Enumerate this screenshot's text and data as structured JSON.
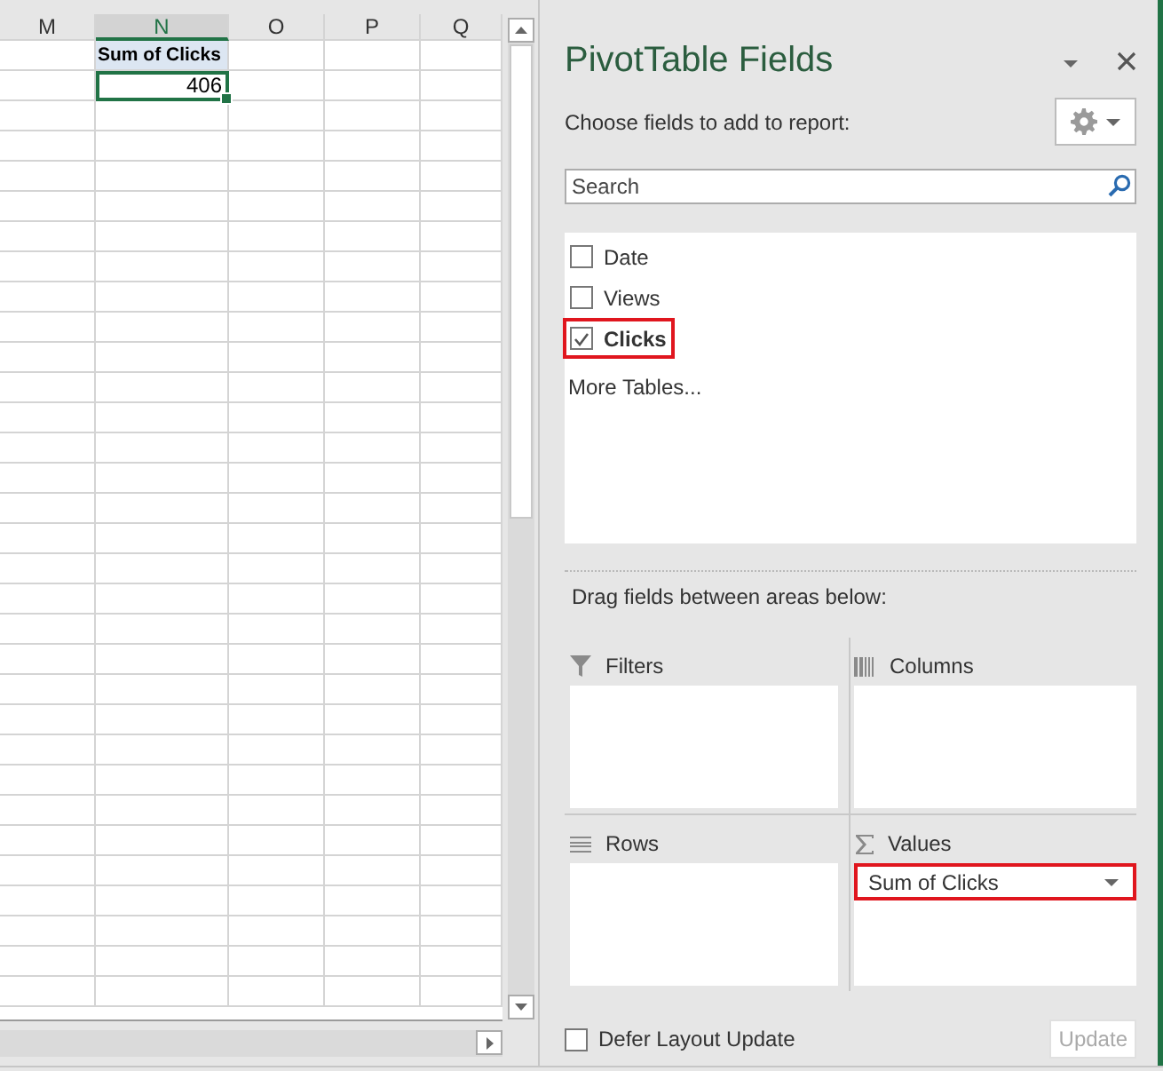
{
  "sheet": {
    "columns": [
      {
        "label": "M",
        "selected": false
      },
      {
        "label": "N",
        "selected": true,
        "cells": [
          {
            "text": "Sum of Clicks",
            "kind": "pivot-header",
            "selected": false
          },
          {
            "text": "406",
            "kind": "value",
            "selected": true
          }
        ]
      },
      {
        "label": "O",
        "selected": false
      },
      {
        "label": "P",
        "selected": false
      },
      {
        "label": "Q",
        "selected": false
      }
    ]
  },
  "panel": {
    "title": "PivotTable Fields",
    "subtitle": "Choose fields to add to report:",
    "search": {
      "placeholder": "Search"
    },
    "fields": [
      {
        "label": "Date",
        "checked": false,
        "highlighted": false
      },
      {
        "label": "Views",
        "checked": false,
        "highlighted": false
      },
      {
        "label": "Clicks",
        "checked": true,
        "highlighted": true
      }
    ],
    "more_tables": "More Tables...",
    "areas_hint": "Drag fields between areas below:",
    "areas": [
      {
        "kind": "filters",
        "label": "Filters"
      },
      {
        "kind": "columns",
        "label": "Columns"
      },
      {
        "kind": "rows",
        "label": "Rows"
      },
      {
        "kind": "values",
        "label": "Values",
        "items": [
          {
            "label": "Sum of Clicks",
            "highlighted": true
          }
        ]
      }
    ],
    "defer": {
      "label": "Defer Layout Update",
      "checked": false
    },
    "update_button": {
      "label": "Update",
      "disabled": true
    }
  }
}
